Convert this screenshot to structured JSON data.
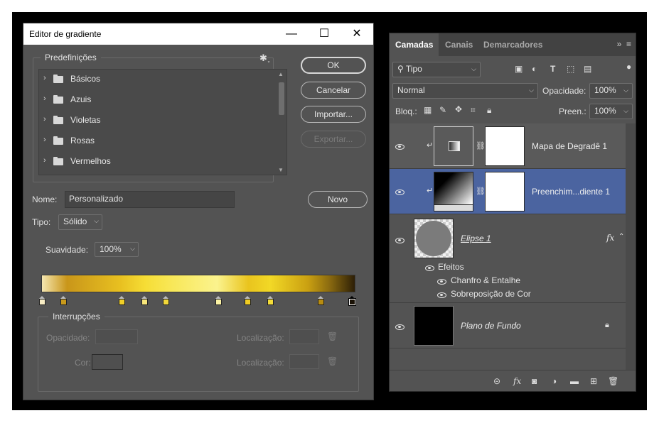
{
  "dialog": {
    "title": "Editor de gradiente",
    "presets": {
      "legend": "Predefinições",
      "items": [
        "Básicos",
        "Azuis",
        "Violetas",
        "Rosas",
        "Vermelhos"
      ]
    },
    "buttons": {
      "ok": "OK",
      "cancel": "Cancelar",
      "import": "Importar...",
      "export": "Exportar...",
      "new": "Novo"
    },
    "name_label": "Nome:",
    "name_value": "Personalizado",
    "type_label": "Tipo:",
    "type_value": "Sólido",
    "smoothness_label": "Suavidade:",
    "smoothness_value": "100%",
    "stops": {
      "legend": "Interrupções",
      "opacity_label": "Opacidade:",
      "color_label": "Cor:",
      "location_label_1": "Localização:",
      "location_label_2": "Localização:"
    }
  },
  "panel": {
    "tabs": [
      "Camadas",
      "Canais",
      "Demarcadores"
    ],
    "filter_kind": "Tipo",
    "blend_mode": "Normal",
    "opacity_label": "Opacidade:",
    "opacity_value": "100%",
    "lock_label": "Bloq.:",
    "fill_label": "Preen.:",
    "fill_value": "100%",
    "layers": [
      {
        "name": "Mapa de Degradê 1"
      },
      {
        "name": "Preenchim...diente 1"
      },
      {
        "name": "Elipse 1",
        "fx": "fx",
        "effects_title": "Efeitos",
        "effects": [
          "Chanfro & Entalhe",
          "Sobreposição de Cor"
        ]
      },
      {
        "name": "Plano de Fundo"
      }
    ]
  },
  "colors": {
    "selected_layer": "#4b64a0",
    "panel_bg": "#535353",
    "dialog_bg": "#535353"
  }
}
